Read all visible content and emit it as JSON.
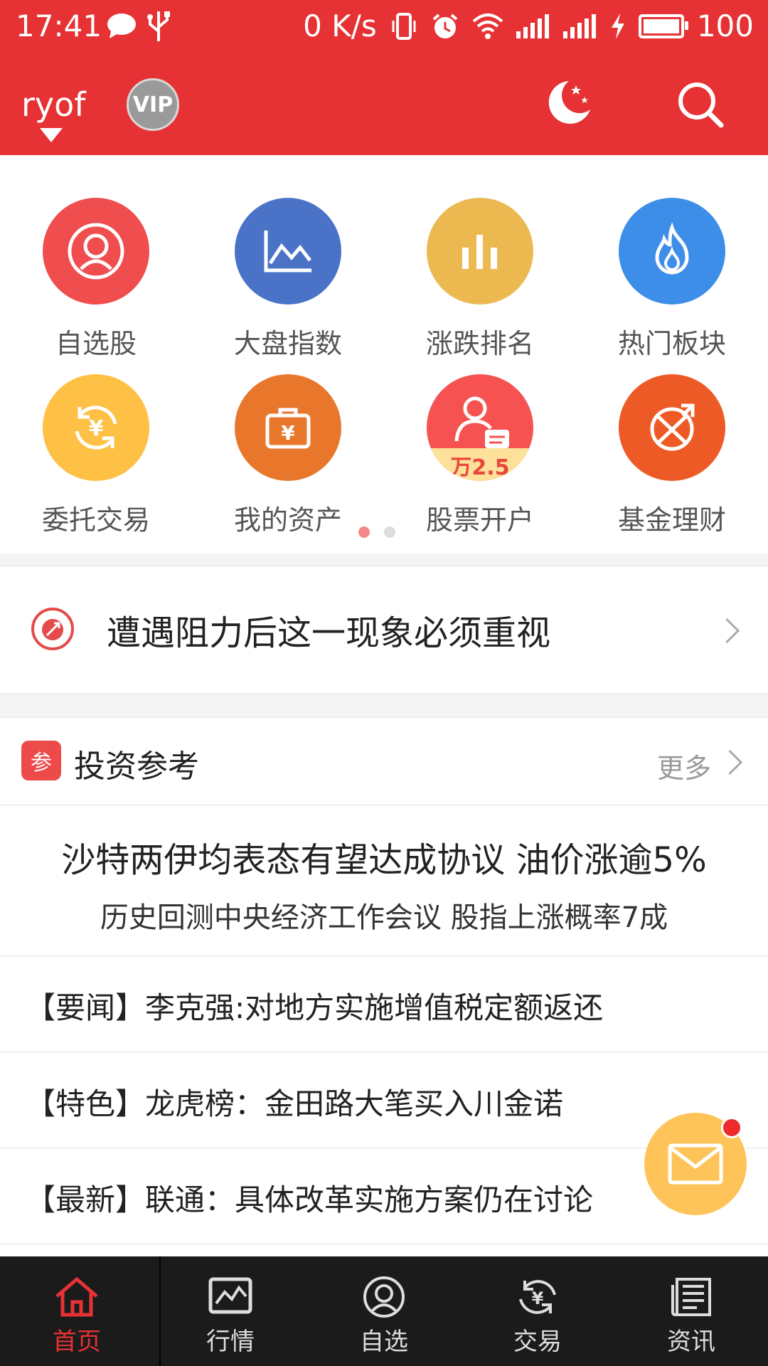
{
  "status_bar": {
    "time": "17:41",
    "net_speed": "0 K/s",
    "battery": "100",
    "icons": [
      "message-icon",
      "usb-icon",
      "vibrate-icon",
      "alarm-icon",
      "wifi-icon",
      "signal-icon",
      "signal-icon",
      "charging-icon",
      "battery-icon"
    ]
  },
  "header": {
    "username": "ryof",
    "vip_label": "VIP",
    "icons": [
      "night-mode-icon",
      "search-icon"
    ]
  },
  "grid": {
    "items": [
      {
        "label": "自选股",
        "color": "#f04d4e",
        "icon": "user-icon"
      },
      {
        "label": "大盘指数",
        "color": "#4a73c8",
        "icon": "line-chart-icon"
      },
      {
        "label": "涨跌排名",
        "color": "#ebb950",
        "icon": "bar-chart-icon"
      },
      {
        "label": "热门板块",
        "color": "#3d8ee8",
        "icon": "flame-icon"
      },
      {
        "label": "委托交易",
        "color": "#fec045",
        "icon": "yuan-exchange-icon"
      },
      {
        "label": "我的资产",
        "color": "#e8772c",
        "icon": "briefcase-icon"
      },
      {
        "label": "股票开户",
        "color": "#f75252",
        "icon": "open-account-icon",
        "badge": "万2.5"
      },
      {
        "label": "基金理财",
        "color": "#ee5a26",
        "icon": "fund-icon"
      }
    ],
    "page_count": 2,
    "page_index": 0
  },
  "headline": {
    "text": "遭遇阻力后这一现象必须重视"
  },
  "invest": {
    "badge": "参",
    "title": "投资参考",
    "more": "更多",
    "featured_main": "沙特两伊均表态有望达成协议 油价涨逾5%",
    "featured_sub": "历史回测中央经济工作会议 股指上涨概率7成",
    "news": [
      "【要闻】李克强:对地方实施增值税定额返还",
      "【特色】龙虎榜：金田路大笔买入川金诺",
      "【最新】联通：具体改革实施方案仍在讨论"
    ]
  },
  "tabs": [
    {
      "label": "首页",
      "icon": "home-icon",
      "active": true
    },
    {
      "label": "行情",
      "icon": "market-icon",
      "active": false
    },
    {
      "label": "自选",
      "icon": "watchlist-icon",
      "active": false
    },
    {
      "label": "交易",
      "icon": "trade-icon",
      "active": false
    },
    {
      "label": "资讯",
      "icon": "news-icon",
      "active": false
    }
  ],
  "colors": {
    "brand_red": "#e63234",
    "tabbar_bg": "#1b1b1b",
    "fab": "#fec45a"
  }
}
